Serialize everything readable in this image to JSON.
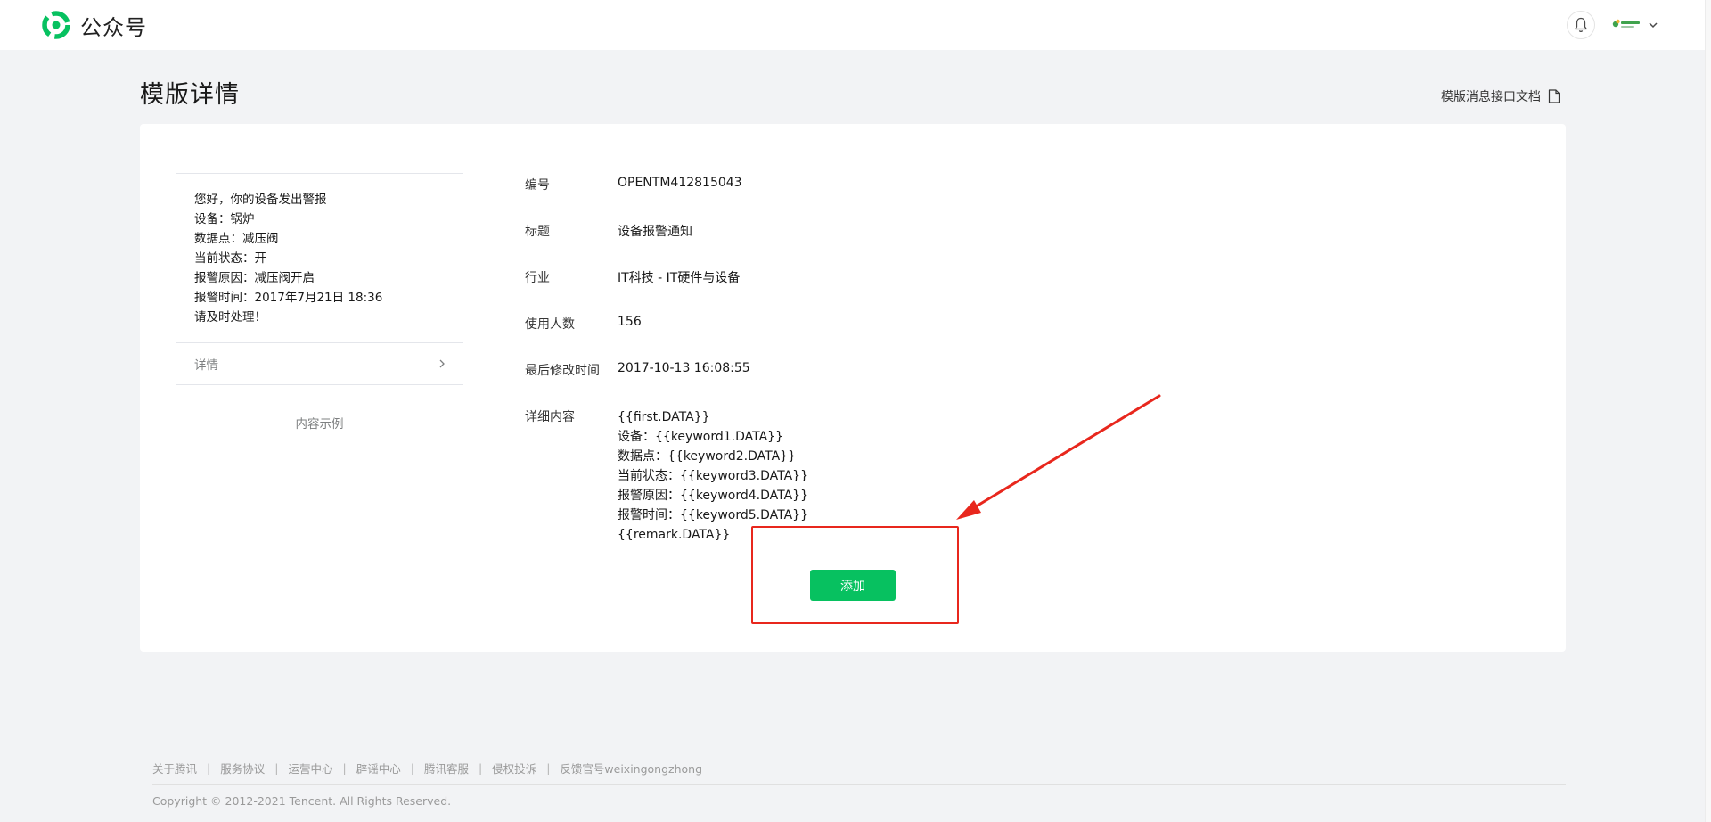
{
  "header": {
    "app_name": "公众号",
    "icons": {
      "logo": "wechat-official-account-logo",
      "bell": "bell-icon",
      "avatar": "account-avatar",
      "caret": "chevron-down-icon"
    }
  },
  "page": {
    "title": "模版详情",
    "doc_link": "模版消息接口文档",
    "doc_icon": "document-icon"
  },
  "sample": {
    "lines": [
      "您好，你的设备发出警报",
      "设备：锅炉",
      "数据点：减压阀",
      "当前状态：开",
      "报警原因：减压阀开启",
      "报警时间：2017年7月21日 18:36",
      "请及时处理！"
    ],
    "details_label": "详情",
    "caption": "内容示例"
  },
  "details": {
    "id_label": "编号",
    "id_value": "OPENTM412815043",
    "title_label": "标题",
    "title_value": "设备报警通知",
    "industry_label": "行业",
    "industry_value": "IT科技 - IT硬件与设备",
    "users_label": "使用人数",
    "users_value": "156",
    "modified_label": "最后修改时间",
    "modified_value": "2017-10-13 16:08:55",
    "content_label": "详细内容",
    "content_lines": [
      "{{first.DATA}}",
      "设备：{{keyword1.DATA}}",
      "数据点：{{keyword2.DATA}}",
      "当前状态：{{keyword3.DATA}}",
      "报警原因：{{keyword4.DATA}}",
      "报警时间：{{keyword5.DATA}}",
      "{{remark.DATA}}"
    ]
  },
  "actions": {
    "add_label": "添加"
  },
  "annotation": {
    "color": "#e8271d"
  },
  "footer": {
    "links": [
      "关于腾讯",
      "服务协议",
      "运营中心",
      "辟谣中心",
      "腾讯客服",
      "侵权投诉",
      "反馈官号weixingongzhong"
    ],
    "copyright": "Copyright © 2012-2021 Tencent. All Rights Reserved."
  },
  "colors": {
    "brand": "#07c160",
    "background": "#f2f3f5",
    "card": "#ffffff"
  }
}
